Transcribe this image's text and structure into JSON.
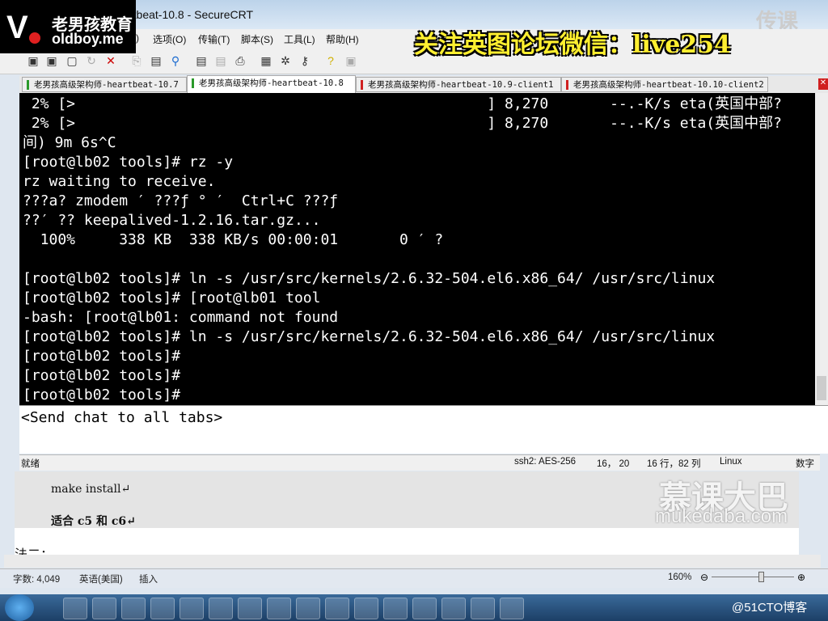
{
  "window": {
    "title": "老男孩高级架构师-heartbeat-10.8 - SecureCRT",
    "title_visible": "rtbeat-10.8 - SecureCRT"
  },
  "logo": {
    "cn": "老男孩教育",
    "en": "oldboy.me"
  },
  "promo": "关注英图论坛微信：live254",
  "menu": [
    "选项(O)",
    "传输(T)",
    "脚本(S)",
    "工具(L)",
    "帮助(H)"
  ],
  "menu_partial": ")",
  "toolbar_icons": [
    "connect-icon",
    "quick-connect-icon",
    "connect-tab-icon",
    "reconnect-icon",
    "disconnect-icon",
    "copy-icon",
    "paste-icon",
    "find-icon",
    "print-setup-icon",
    "log-icon",
    "print-icon",
    "session-options-icon",
    "global-options-icon",
    "key-icon",
    "help-icon",
    "sftp-icon"
  ],
  "tabs": [
    {
      "label": "老男孩高级架构师-heartbeat-10.7",
      "status_color": "#2a9a2a"
    },
    {
      "label": "老男孩高级架构师-heartbeat-10.8",
      "status_color": "#2a9a2a",
      "active": true
    },
    {
      "label": "老男孩高级架构师-heartbeat-10.9-client1",
      "status_color": "#d02020"
    },
    {
      "label": "老男孩高级架构师-heartbeat-10.10-client2",
      "status_color": "#d02020"
    }
  ],
  "terminal": {
    "lines": [
      " 2% [>                                               ] 8,270       --.-K/s eta(英国中部?",
      " 2% [>                                               ] 8,270       --.-K/s eta(英国中部?",
      "间) 9m 6s^C",
      "[root@lb02 tools]# rz -y",
      "rz waiting to receive.",
      "???a? zmodem ′ ???ƒ ° ′  Ctrl+C ???ƒ",
      "??′ ?? keepalived-1.2.16.tar.gz...",
      "  100%     338 KB  338 KB/s 00:00:01       0 ′ ?",
      "",
      "[root@lb02 tools]# ln -s /usr/src/kernels/2.6.32-504.el6.x86_64/ /usr/src/linux",
      "[root@lb02 tools]# [root@lb01 tool",
      "-bash: [root@lb01: command not found",
      "[root@lb02 tools]# ln -s /usr/src/kernels/2.6.32-504.el6.x86_64/ /usr/src/linux",
      "[root@lb02 tools]#",
      "[root@lb02 tools]#",
      "[root@lb02 tools]#"
    ]
  },
  "chat": {
    "placeholder": "<Send chat to all tabs>"
  },
  "crt_status": {
    "ready": "就绪",
    "cipher": "ssh2: AES-256",
    "cursor": "16， 20",
    "size": "16 行，82 列",
    "os": "Linux",
    "numlock": "数字"
  },
  "document": {
    "lines": [
      "make install↵",
      "适合 c5 和 c6↵",
      "法二："
    ]
  },
  "watermark": {
    "cn": "慕课大巴",
    "en": "mukedaba.com",
    "corner": "传课"
  },
  "word_status": {
    "words": "字数: 4,049",
    "lang": "英语(美国)",
    "mode": "插入",
    "zoom": "160%",
    "zoom_level": 0.6
  },
  "taskbar": {
    "tray_text": "@51CTO博客"
  }
}
